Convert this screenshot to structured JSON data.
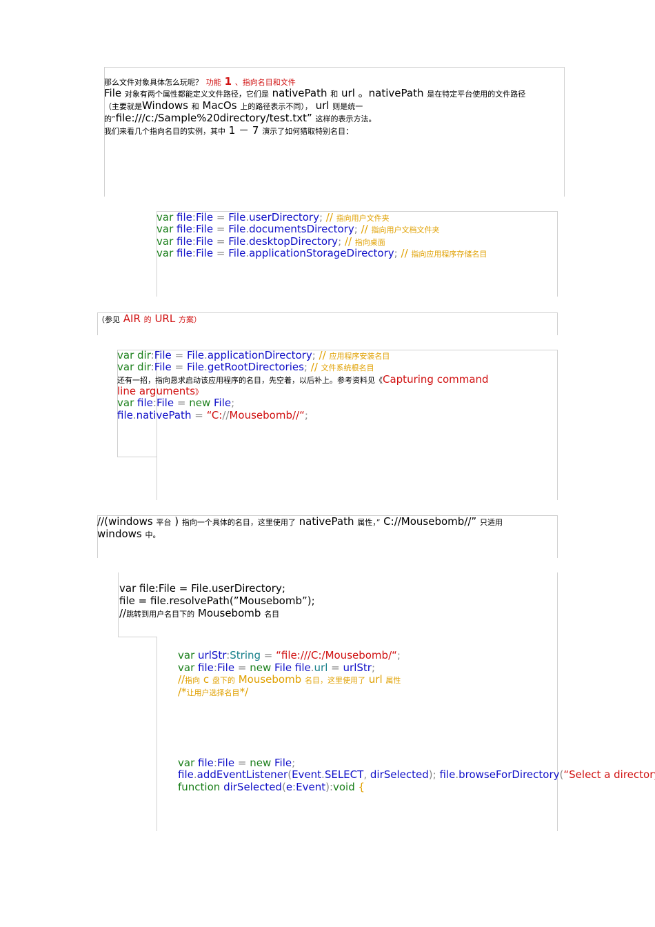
{
  "intro": {
    "q_text": "那么文件对象具体怎么玩呢？",
    "feature_prefix": "功能",
    "feature_num": "1",
    "feature_title": "、指向名目和文件",
    "p1": {
      "a": "File",
      "b": "对象有两个属性都能定义文件路径，它们是",
      "c": "nativePath",
      "d": "和",
      "e": "url",
      "f": "。nativePath",
      "g": "是在特定平台使用的文件路径"
    },
    "p2": {
      "a": "（主要就是",
      "b": "Windows",
      "c": "和",
      "d": "MacOs",
      "e": "上的路径表示不同），",
      "f": "url",
      "g": "则是统一"
    },
    "p3": {
      "a": "的”",
      "b": "file:///c:/Sample%20directory/test.txt”",
      "c": "这样的表示方法。"
    },
    "p4": {
      "a": "我们来看几个指向名目的实例，其中",
      "b": "1 － 7",
      "c": "演示了如何猎取特别名目："
    }
  },
  "code1": [
    {
      "decl": "var",
      "name": "file",
      "type": "File",
      "cls": "File",
      "member": "userDirectory",
      "cmt_slash": "//",
      "cmt": "指向用户文件夹"
    },
    {
      "decl": "var",
      "name": "file",
      "type": "File",
      "cls": "File",
      "member": "documentsDirectory",
      "cmt_slash": "//",
      "cmt": "指向用户文档文件夹"
    },
    {
      "decl": "var",
      "name": "file",
      "type": "File",
      "cls": "File",
      "member": "desktopDirectory",
      "cmt_slash": "//",
      "cmt": "指向桌面"
    },
    {
      "decl": "var",
      "name": "file",
      "type": "File",
      "cls": "File",
      "member": "applicationStorageDirectory",
      "cmt_slash": "//",
      "cmt": "指向应用程序存储名目"
    }
  ],
  "note_url": {
    "a": "（参见",
    "b": "AIR",
    "c": "的",
    "d": "URL",
    "e": "方案）"
  },
  "code2": {
    "l1": {
      "decl": "var",
      "name": "dir",
      "type": "File",
      "cls": "File",
      "member": "applicationDirectory",
      "cmt_slash": "//",
      "cmt": "应用程序安装名目"
    },
    "l2": {
      "decl": "var",
      "name": "dir",
      "type": "File",
      "cls": "File",
      "member": "getRootDirectories",
      "cmt_slash": "//",
      "cmt": "文件系统根名目"
    },
    "l3": {
      "a": "还有一招，指向恳求启动该应用程序的名目，先空着，以后补上。参考资料见《",
      "b": "Capturing command"
    },
    "l4": {
      "a": "line arguments",
      "b": "》"
    },
    "l5": {
      "decl": "var",
      "name": "file",
      "type": "File",
      "kw": "new",
      "cls": "File"
    },
    "l6": {
      "obj": "file",
      "prop": "nativePath",
      "str_open": "“C:",
      "str_slash": "//",
      "str_mid": "Mousebomb",
      "str_end": "//“"
    }
  },
  "win_note": {
    "a": "//(windows",
    "b": "平台",
    "c": ")",
    "d": "指向一个具体的名目，这里使用了",
    "e": "nativePath",
    "f": "属性，”",
    "g": "C://Mousebomb//”",
    "h": "只适用",
    "i": "windows",
    "j": "中。"
  },
  "code3": {
    "l1": "var file:File = File.userDirectory;",
    "l2": "file = file.resolvePath(”Mousebomb”);",
    "l3a": "//",
    "l3b": "跳转到用户名目下的",
    "l3c": "Mousebomb",
    "l3d": "名目"
  },
  "code4": {
    "l1": {
      "decl": "var",
      "name": "urlStr",
      "type": "String",
      "str": "“file:///C:/Mousebomb/“"
    },
    "l2": {
      "decl": "var",
      "name": "file",
      "type": "File",
      "kw": "new",
      "cls": "File",
      "obj": "file",
      "prop": "url",
      "val": "urlStr"
    },
    "l3": {
      "a": "//",
      "b": "指向",
      "c": "c",
      "d": "盘下的",
      "e": "Mousebomb",
      "f": "名目，这里使用了",
      "g": "url",
      "h": "属性"
    },
    "l4": {
      "a": "/*",
      "b": "让用户选择名目",
      "c": "*/"
    }
  },
  "code5": {
    "l1": {
      "decl": "var",
      "name": "file",
      "type": "File",
      "kw": "new",
      "cls": "File"
    },
    "l2": {
      "obj": "file",
      "m1": "addEventListener",
      "arg1cls": "Event",
      "arg1": "SELECT",
      "arg2": "dirSelected",
      "obj2": "file",
      "m2": "browseForDirectory",
      "str": "“Select a directory"
    },
    "l3": {
      "kw": "function",
      "fn": "dirSelected",
      "param": "e",
      "ptype": "Event",
      "ret": "void",
      "brace": "{"
    }
  }
}
